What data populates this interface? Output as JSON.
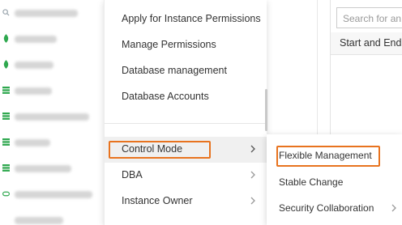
{
  "menu": {
    "items": [
      {
        "label": "Apply for Instance Permissions",
        "has_submenu": false
      },
      {
        "label": "Manage Permissions",
        "has_submenu": false
      },
      {
        "label": "Database management",
        "has_submenu": false
      },
      {
        "label": "Database Accounts",
        "has_submenu": false
      },
      {
        "label": "Control Mode",
        "has_submenu": true,
        "active": true
      },
      {
        "label": "DBA",
        "has_submenu": true
      },
      {
        "label": "Instance Owner",
        "has_submenu": true
      }
    ]
  },
  "submenu": {
    "items": [
      {
        "label": "Flexible Management",
        "has_submenu": false
      },
      {
        "label": "Stable Change",
        "has_submenu": false
      },
      {
        "label": "Security Collaboration",
        "has_submenu": true
      }
    ]
  },
  "right_panel": {
    "search_placeholder": "Search for an S",
    "column_header": "Start and End"
  },
  "colors": {
    "highlight": "#e8731f",
    "status_green": "#2fa84f",
    "text": "#333333"
  }
}
